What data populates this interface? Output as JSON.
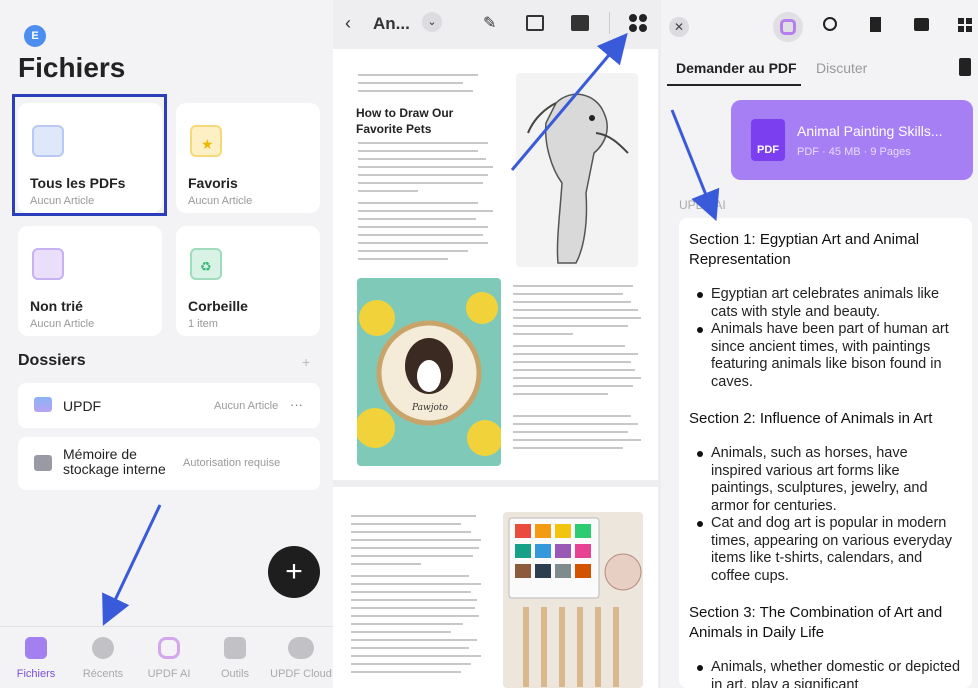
{
  "left": {
    "avatar_letter": "E",
    "title": "Fichiers",
    "cards": [
      {
        "name": "Tous les PDFs",
        "sub": "Aucun Article"
      },
      {
        "name": "Favoris",
        "sub": "Aucun Article"
      },
      {
        "name": "Non trié",
        "sub": "Aucun Article"
      },
      {
        "name": "Corbeille",
        "sub": "1 item"
      }
    ],
    "folders_title": "Dossiers",
    "folders_add": "+",
    "folders": [
      {
        "name": "UPDF",
        "right": "Aucun Article",
        "more": "···"
      },
      {
        "name_l1": "Mémoire de",
        "name_l2": "stockage interne",
        "right": "Autorisation requise"
      }
    ],
    "fab": "+",
    "nav": [
      "Fichiers",
      "Récents",
      "UPDF AI",
      "Outils",
      "UPDF Cloud"
    ]
  },
  "mid": {
    "doc_title": "An...",
    "page_heading_1": "How to Draw Our",
    "page_heading_2": "Favorite Pets",
    "dog_caption": "Pawjoto"
  },
  "right": {
    "tabs": [
      "Demander au PDF",
      "Discuter"
    ],
    "file": {
      "name": "Animal Painting Skills...",
      "meta": "PDF · 45 MB · 9 Pages",
      "badge": "PDF"
    },
    "ai_label": "UPDF AI",
    "sections": [
      {
        "title": "Section 1: Egyptian Art and Animal Representation",
        "bullets": [
          "Egyptian art celebrates animals like cats with style and beauty.",
          "Animals have been part of human art since ancient times, with paintings featuring animals like bison found in caves."
        ]
      },
      {
        "title": "Section 2: Influence of Animals in Art",
        "bullets": [
          "Animals, such as horses, have inspired various art forms like paintings, sculptures, jewelry, and armor for centuries.",
          "Cat and dog art is popular in modern times, appearing on various everyday items like t-shirts, calendars, and coffee cups."
        ]
      },
      {
        "title": "Section 3: The Combination of Art and Animals in Daily Life",
        "bullets": [
          "Animals, whether domestic or depicted in art, play a significant"
        ]
      }
    ]
  },
  "colors": {
    "accent_arrow": "#3a5bd9",
    "selection_border": "#2b3fbb",
    "pdf_card": "#a77ff5"
  }
}
